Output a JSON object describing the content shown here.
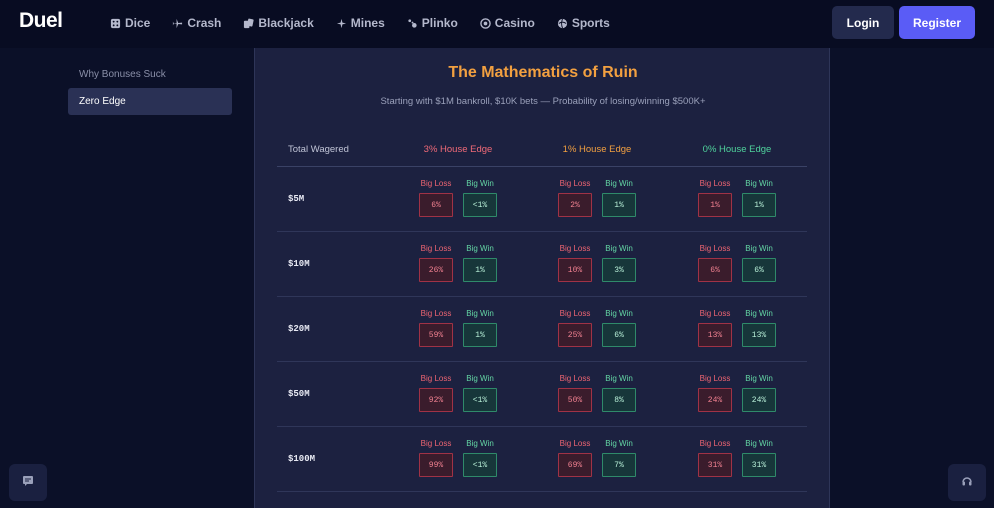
{
  "header": {
    "logo": "Duel",
    "nav": [
      {
        "label": "Dice",
        "icon": "dice-icon"
      },
      {
        "label": "Crash",
        "icon": "plane-icon"
      },
      {
        "label": "Blackjack",
        "icon": "cards-icon"
      },
      {
        "label": "Mines",
        "icon": "bomb-icon"
      },
      {
        "label": "Plinko",
        "icon": "plinko-icon"
      },
      {
        "label": "Casino",
        "icon": "chip-icon"
      },
      {
        "label": "Sports",
        "icon": "ball-icon"
      }
    ],
    "login_label": "Login",
    "register_label": "Register"
  },
  "sidebar": {
    "items": [
      {
        "label": "Why Bonuses Suck"
      },
      {
        "label": "Zero Edge",
        "active": true
      }
    ]
  },
  "main": {
    "title": "The Mathematics of Ruin",
    "subtitle": "Starting with $1M bankroll, $10K bets — Probability of losing/winning $500K+",
    "table": {
      "col_total": "Total Wagered",
      "columns": [
        "3% House Edge",
        "1% House Edge",
        "0% House Edge"
      ],
      "loss_label": "Big Loss",
      "win_label": "Big Win",
      "rows": [
        {
          "wagered": "$5M",
          "cells": [
            {
              "loss": "6%",
              "win": "<1%"
            },
            {
              "loss": "2%",
              "win": "1%"
            },
            {
              "loss": "1%",
              "win": "1%"
            }
          ]
        },
        {
          "wagered": "$10M",
          "cells": [
            {
              "loss": "26%",
              "win": "1%"
            },
            {
              "loss": "10%",
              "win": "3%"
            },
            {
              "loss": "6%",
              "win": "6%"
            }
          ]
        },
        {
          "wagered": "$20M",
          "cells": [
            {
              "loss": "59%",
              "win": "1%"
            },
            {
              "loss": "25%",
              "win": "6%"
            },
            {
              "loss": "13%",
              "win": "13%"
            }
          ]
        },
        {
          "wagered": "$50M",
          "cells": [
            {
              "loss": "92%",
              "win": "<1%"
            },
            {
              "loss": "50%",
              "win": "8%"
            },
            {
              "loss": "24%",
              "win": "24%"
            }
          ]
        },
        {
          "wagered": "$100M",
          "cells": [
            {
              "loss": "99%",
              "win": "<1%"
            },
            {
              "loss": "69%",
              "win": "7%"
            },
            {
              "loss": "31%",
              "win": "31%"
            }
          ]
        }
      ]
    }
  },
  "colors": {
    "background": "#0b1028",
    "panel": "#1c2140",
    "title": "#f2a040",
    "edge3": "#f06a78",
    "edge1": "#f2a040",
    "edge0": "#4fd39c",
    "register": "#5a5cf6"
  },
  "floating": {
    "left_icon": "chat-icon",
    "right_icon": "headset-icon"
  }
}
